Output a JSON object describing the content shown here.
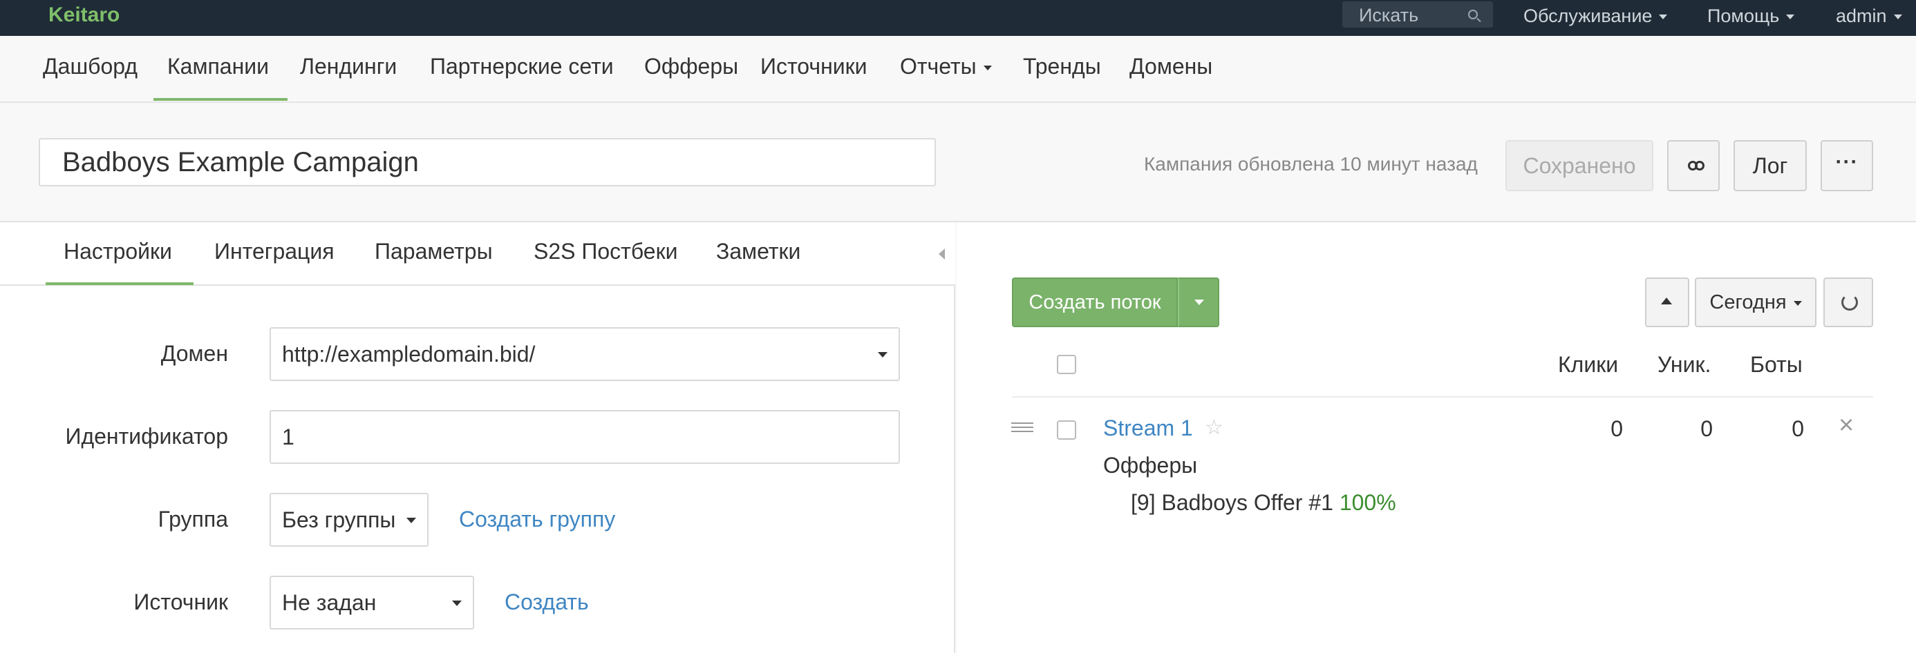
{
  "topbar": {
    "brand": "Keitaro",
    "search_placeholder": "Искать",
    "menu": [
      {
        "label": "Обслуживание"
      },
      {
        "label": "Помощь"
      },
      {
        "label": "admin"
      }
    ]
  },
  "mainnav": {
    "items": [
      "Дашборд",
      "Кампании",
      "Лендинги",
      "Партнерские сети",
      "Офферы",
      "Источники",
      "Отчеты",
      "Тренды",
      "Домены"
    ],
    "active": "Кампании"
  },
  "campaign": {
    "name": "Badboys Example Campaign",
    "updated_text": "Кампания обновлена 10 минут назад",
    "saved_label": "Сохранено",
    "log_label": "Лог",
    "more_label": "···"
  },
  "left_tabs": {
    "items": [
      "Настройки",
      "Интеграция",
      "Параметры",
      "S2S Постбеки",
      "Заметки"
    ],
    "active": "Настройки"
  },
  "form": {
    "domain_label": "Домен",
    "domain_value": "http://exampledomain.bid/",
    "id_label": "Идентификатор",
    "id_value": "1",
    "group_label": "Группа",
    "group_value": "Без группы",
    "create_group_link": "Создать группу",
    "source_label": "Источник",
    "source_value": "Не задан",
    "create_source_link": "Создать"
  },
  "streams": {
    "create_label": "Создать поток",
    "period_label": "Сегодня",
    "columns": [
      "Клики",
      "Уник.",
      "Боты"
    ],
    "rows": [
      {
        "name": "Stream 1",
        "clicks": "0",
        "unique": "0",
        "bots": "0",
        "offers_label": "Офферы",
        "offer_name": "[9] Badboys Offer #1",
        "offer_share": "100%"
      }
    ]
  },
  "colors": {
    "topbar_bg": "#1f2b36",
    "brand_green": "#7fbf6a",
    "accent_green": "#7bb36b",
    "link_blue": "#3f86c3"
  }
}
